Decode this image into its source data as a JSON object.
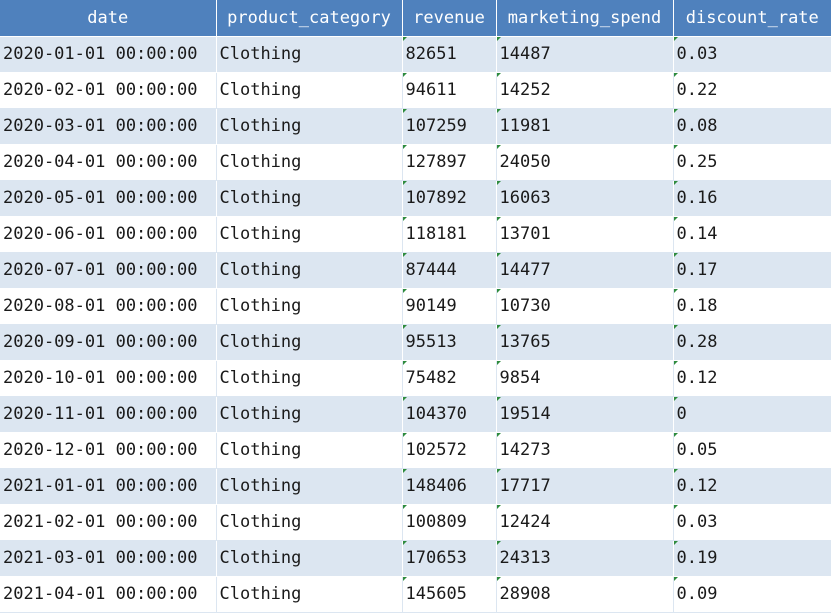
{
  "table": {
    "headers": [
      "date",
      "product_category",
      "revenue",
      "marketing_spend",
      "discount_rate"
    ],
    "rows": [
      [
        "2020-01-01 00:00:00",
        "Clothing",
        "82651",
        "14487",
        "0.03"
      ],
      [
        "2020-02-01 00:00:00",
        "Clothing",
        "94611",
        "14252",
        "0.22"
      ],
      [
        "2020-03-01 00:00:00",
        "Clothing",
        "107259",
        "11981",
        "0.08"
      ],
      [
        "2020-04-01 00:00:00",
        "Clothing",
        "127897",
        "24050",
        "0.25"
      ],
      [
        "2020-05-01 00:00:00",
        "Clothing",
        "107892",
        "16063",
        "0.16"
      ],
      [
        "2020-06-01 00:00:00",
        "Clothing",
        "118181",
        "13701",
        "0.14"
      ],
      [
        "2020-07-01 00:00:00",
        "Clothing",
        "87444",
        "14477",
        "0.17"
      ],
      [
        "2020-08-01 00:00:00",
        "Clothing",
        "90149",
        "10730",
        "0.18"
      ],
      [
        "2020-09-01 00:00:00",
        "Clothing",
        "95513",
        "13765",
        "0.28"
      ],
      [
        "2020-10-01 00:00:00",
        "Clothing",
        "75482",
        "9854",
        "0.12"
      ],
      [
        "2020-11-01 00:00:00",
        "Clothing",
        "104370",
        "19514",
        "0"
      ],
      [
        "2020-12-01 00:00:00",
        "Clothing",
        "102572",
        "14273",
        "0.05"
      ],
      [
        "2021-01-01 00:00:00",
        "Clothing",
        "148406",
        "17717",
        "0.12"
      ],
      [
        "2021-02-01 00:00:00",
        "Clothing",
        "100809",
        "12424",
        "0.03"
      ],
      [
        "2021-03-01 00:00:00",
        "Clothing",
        "170653",
        "24313",
        "0.19"
      ],
      [
        "2021-04-01 00:00:00",
        "Clothing",
        "145605",
        "28908",
        "0.09"
      ]
    ]
  },
  "colors": {
    "header_bg": "#4f81bd",
    "header_text": "#ffffff",
    "band_bg": "#dce6f1",
    "text_marker": "#2e8b3e"
  }
}
